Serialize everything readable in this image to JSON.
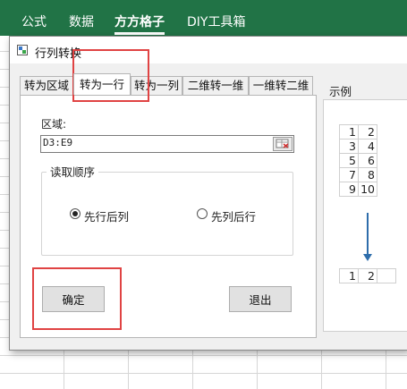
{
  "ribbon": {
    "tabs": [
      {
        "label": "公式"
      },
      {
        "label": "数据"
      },
      {
        "label": "方方格子"
      },
      {
        "label": "DIY工具箱"
      }
    ],
    "color": "#217346"
  },
  "dialog": {
    "title": "行列转换",
    "tabs": [
      {
        "label": "转为区域"
      },
      {
        "label": "转为一行"
      },
      {
        "label": "转为一列"
      },
      {
        "label": "二维转一维"
      },
      {
        "label": "一维转二维"
      }
    ],
    "active_tab": "转为一行",
    "region_label": "区域:",
    "region_value": "D3:E9",
    "order_group_label": "读取顺序",
    "radio_row_first": "先行后列",
    "radio_col_first": "先列后行",
    "selected_order": "先行后列",
    "ok_label": "确定",
    "exit_label": "退出"
  },
  "example": {
    "label": "示例",
    "source_rows": [
      [
        "1",
        "2"
      ],
      [
        "3",
        "4"
      ],
      [
        "5",
        "6"
      ],
      [
        "7",
        "8"
      ],
      [
        "9",
        "10"
      ]
    ],
    "result_row": [
      "1",
      "2"
    ]
  },
  "highlight_color": "#e04343"
}
